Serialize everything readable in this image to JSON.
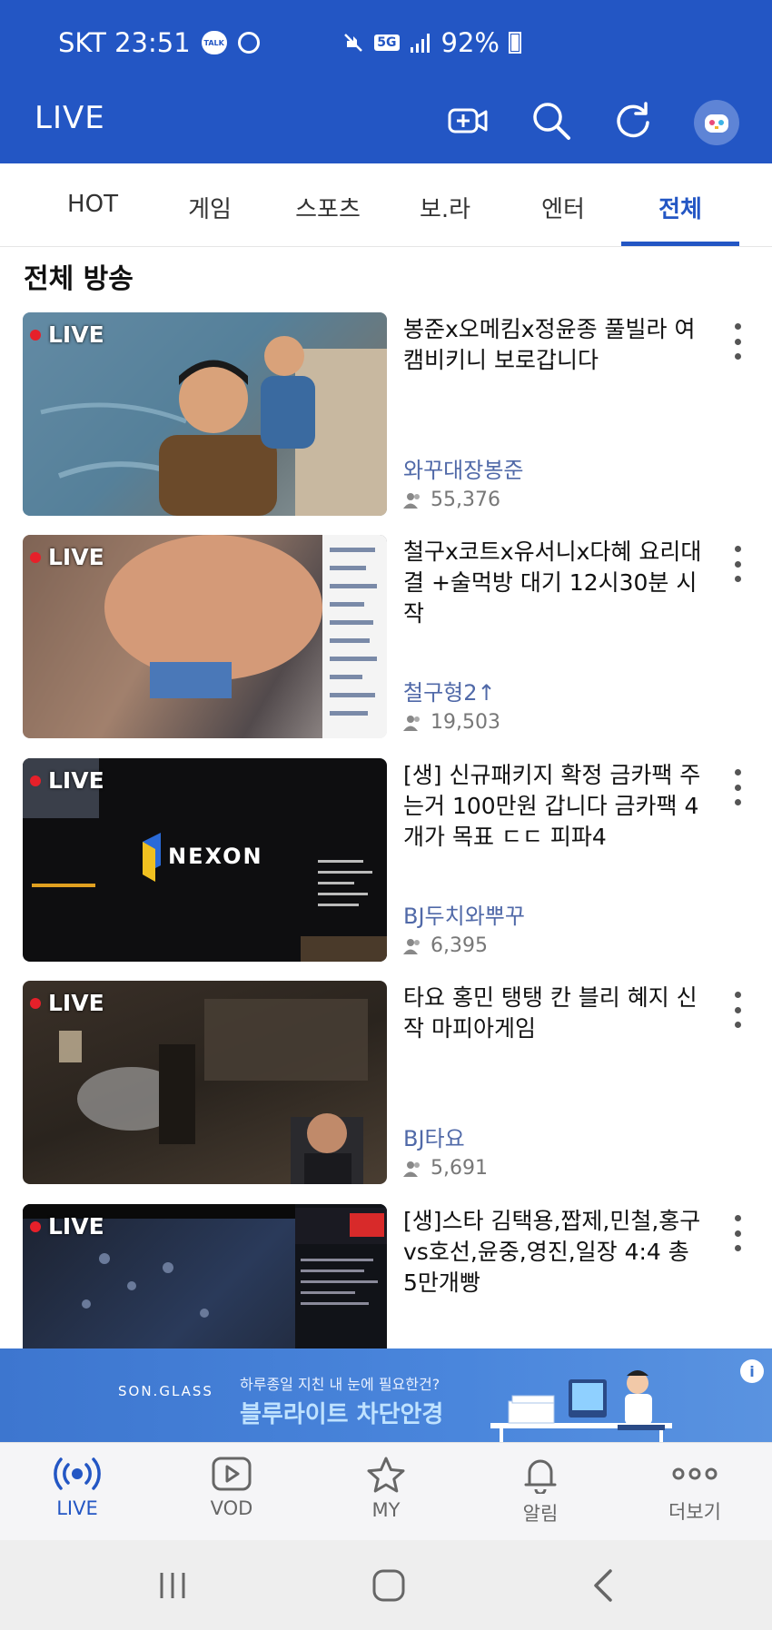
{
  "status_bar": {
    "carrier_time": "SKT 23:51",
    "network": "5G",
    "battery": "92%"
  },
  "app_bar": {
    "title": "LIVE"
  },
  "tabs": [
    {
      "label": "HOT"
    },
    {
      "label": "게임"
    },
    {
      "label": "스포츠"
    },
    {
      "label": "보.라"
    },
    {
      "label": "엔터"
    },
    {
      "label": "전체"
    }
  ],
  "section_title": "전체 방송",
  "live_label": "LIVE",
  "streams": [
    {
      "title": "봉준x오메킴x정윤종 풀빌라 여캠비키니 보로갑니다",
      "channel": "와꾸대장봉준",
      "viewers": "55,376"
    },
    {
      "title": "철구x코트x유서니x다혜 요리대결 +술먹방 대기 12시30분 시작",
      "channel": "철구형2↑",
      "viewers": "19,503"
    },
    {
      "title": "[생] 신규패키지 확정 금카팩 주는거 100만원 갑니다 금카팩 4개가 목표 ㄷㄷ 피파4",
      "channel": "BJ두치와뿌꾸",
      "viewers": "6,395",
      "thumb_text": "NEXON"
    },
    {
      "title": "타요 홍민 탱탱 칸 블리 혜지 신작 마피아게임",
      "channel": "BJ타요",
      "viewers": "5,691"
    },
    {
      "title": "[생]스타 김택용,짭제,민철,홍구vs호선,윤중,영진,일장 4:4 총5만개빵",
      "channel": "",
      "viewers": ""
    }
  ],
  "ad": {
    "brand": "SON.GLASS",
    "subtitle": "하루종일 지친 내 눈에 필요한건?",
    "headline": "블루라이트 차단안경",
    "info": "i"
  },
  "bottom_nav": [
    {
      "label": "LIVE"
    },
    {
      "label": "VOD"
    },
    {
      "label": "MY"
    },
    {
      "label": "알림"
    },
    {
      "label": "더보기"
    }
  ],
  "colors": {
    "primary": "#2356c4",
    "live_dot": "#e6202a",
    "channel": "#5069a8"
  }
}
